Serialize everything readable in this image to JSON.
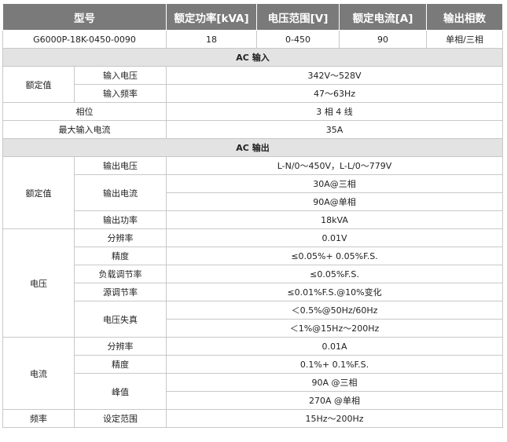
{
  "header": {
    "model": "型号",
    "power": "额定功率[kVA]",
    "voltage_range": "电压范围[V]",
    "current": "额定电流[A]",
    "phases": "输出相数"
  },
  "model_row": {
    "model": "G6000P-18K-0450-0090",
    "power": "18",
    "voltage_range": "0-450",
    "current": "90",
    "phases": "单相/三相"
  },
  "ac_input": {
    "title": "AC 输入",
    "rated_label": "额定值",
    "input_voltage_label": "输入电压",
    "input_voltage": "342V～528V",
    "input_freq_label": "输入频率",
    "input_freq": "47～63Hz",
    "phase_label": "相位",
    "phase": "3 相 4 线",
    "max_current_label": "最大输入电流",
    "max_current": "35A"
  },
  "ac_output": {
    "title": "AC 输出",
    "rated_label": "额定值",
    "out_voltage_label": "输出电压",
    "out_voltage": "L-N/0～450V，L-L/0～779V",
    "out_current_label": "输出电流",
    "out_current_3ph": "30A@三相",
    "out_current_1ph": "90A@单相",
    "out_power_label": "输出功率",
    "out_power": "18kVA",
    "voltage_label": "电压",
    "v_resolution_label": "分辨率",
    "v_resolution": "0.01V",
    "v_accuracy_label": "精度",
    "v_accuracy": "≤0.05%+ 0.05%F.S.",
    "v_load_reg_label": "负载调节率",
    "v_load_reg": "≤0.05%F.S.",
    "v_line_reg_label": "源调节率",
    "v_line_reg": "≤0.01%F.S.@10%变化",
    "v_thd_label": "电压失真",
    "v_thd_1": "＜0.5%@50Hz/60Hz",
    "v_thd_2": "＜1%@15Hz～200Hz",
    "current_label": "电流",
    "c_resolution_label": "分辨率",
    "c_resolution": "0.01A",
    "c_accuracy_label": "精度",
    "c_accuracy": "0.1%+ 0.1%F.S.",
    "c_peak_label": "峰值",
    "c_peak_3ph": "90A @三相",
    "c_peak_1ph": "270A @单相",
    "freq_label": "频率",
    "f_range_label": "设定范围",
    "f_range": "15Hz～200Hz"
  }
}
